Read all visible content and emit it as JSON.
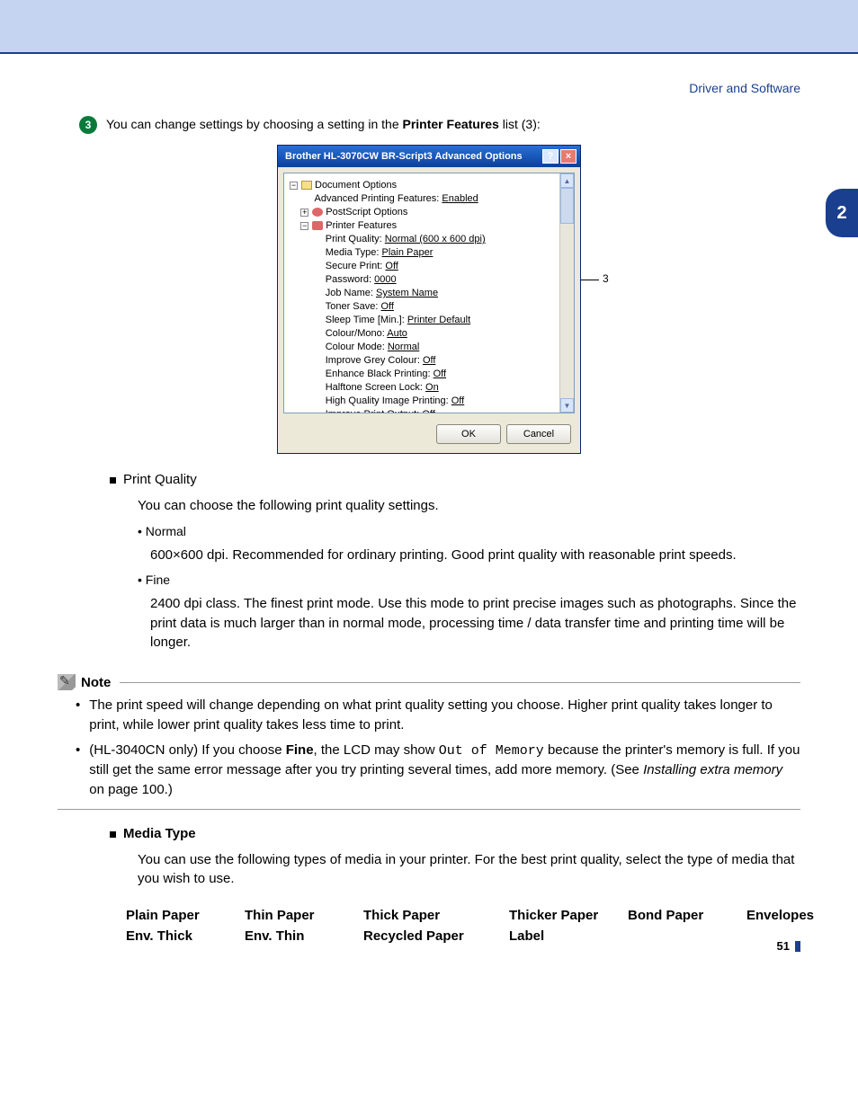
{
  "header": {
    "section": "Driver and Software"
  },
  "chapter_tab": "2",
  "step": {
    "number": "3",
    "text_prefix": "You can change settings by choosing a setting in the ",
    "text_bold": "Printer Features",
    "text_suffix": " list (3):"
  },
  "dialog": {
    "title": "Brother HL-3070CW BR-Script3 Advanced Options",
    "tree": {
      "doc_options": "Document Options",
      "apf_label": "Advanced Printing Features:",
      "apf_value": "Enabled",
      "ps_options": "PostScript Options",
      "pf": "Printer Features",
      "items": [
        {
          "label": "Print Quality:",
          "value": "Normal (600 x 600 dpi)"
        },
        {
          "label": "Media Type:",
          "value": "Plain Paper"
        },
        {
          "label": "Secure Print:",
          "value": "Off"
        },
        {
          "label": "Password:",
          "value": "0000"
        },
        {
          "label": "Job Name:",
          "value": "System Name"
        },
        {
          "label": "Toner Save:",
          "value": "Off"
        },
        {
          "label": "Sleep Time [Min.]:",
          "value": "Printer Default"
        },
        {
          "label": "Colour/Mono:",
          "value": "Auto"
        },
        {
          "label": "Colour Mode:",
          "value": "Normal"
        },
        {
          "label": "Improve Grey Colour:",
          "value": "Off"
        },
        {
          "label": "Enhance Black Printing:",
          "value": "Off"
        },
        {
          "label": "Halftone Screen Lock:",
          "value": "On"
        },
        {
          "label": "High Quality Image Printing:",
          "value": "Off"
        },
        {
          "label": "Improve Print Output:",
          "value": "Off"
        }
      ]
    },
    "ok": "OK",
    "cancel": "Cancel",
    "callout": "3"
  },
  "print_quality": {
    "title": "Print Quality",
    "desc": "You can choose the following print quality settings.",
    "normal": {
      "name": "Normal",
      "desc": "600×600 dpi. Recommended for ordinary printing. Good print quality with reasonable print speeds."
    },
    "fine": {
      "name": "Fine",
      "desc": "2400 dpi class. The finest print mode. Use this mode to print precise images such as photographs. Since the print data is much larger than in normal mode, processing time / data transfer time and printing time will be longer."
    }
  },
  "note": {
    "label": "Note",
    "item1": "The print speed will change depending on what print quality setting you choose. Higher print quality takes longer to print, while lower print quality takes less time to print.",
    "item2_a": "(HL-3040CN only) If you choose ",
    "item2_b": "Fine",
    "item2_c": ", the LCD may show ",
    "item2_mono": "Out of Memory",
    "item2_d": " because the printer's memory is full. If you still get the same error message after you try printing several times, add more memory. (See ",
    "item2_link": "Installing extra memory",
    "item2_e": " on page 100.)"
  },
  "media_type": {
    "title": "Media Type",
    "desc": "You can use the following types of media in your printer. For the best print quality, select the type of media that you wish to use.",
    "items": [
      "Plain Paper",
      "Thin Paper",
      "Thick Paper",
      "Thicker Paper",
      "Bond Paper",
      "Envelopes",
      "Env. Thick",
      "Env. Thin",
      "Recycled Paper",
      "Label"
    ]
  },
  "page_number": "51"
}
